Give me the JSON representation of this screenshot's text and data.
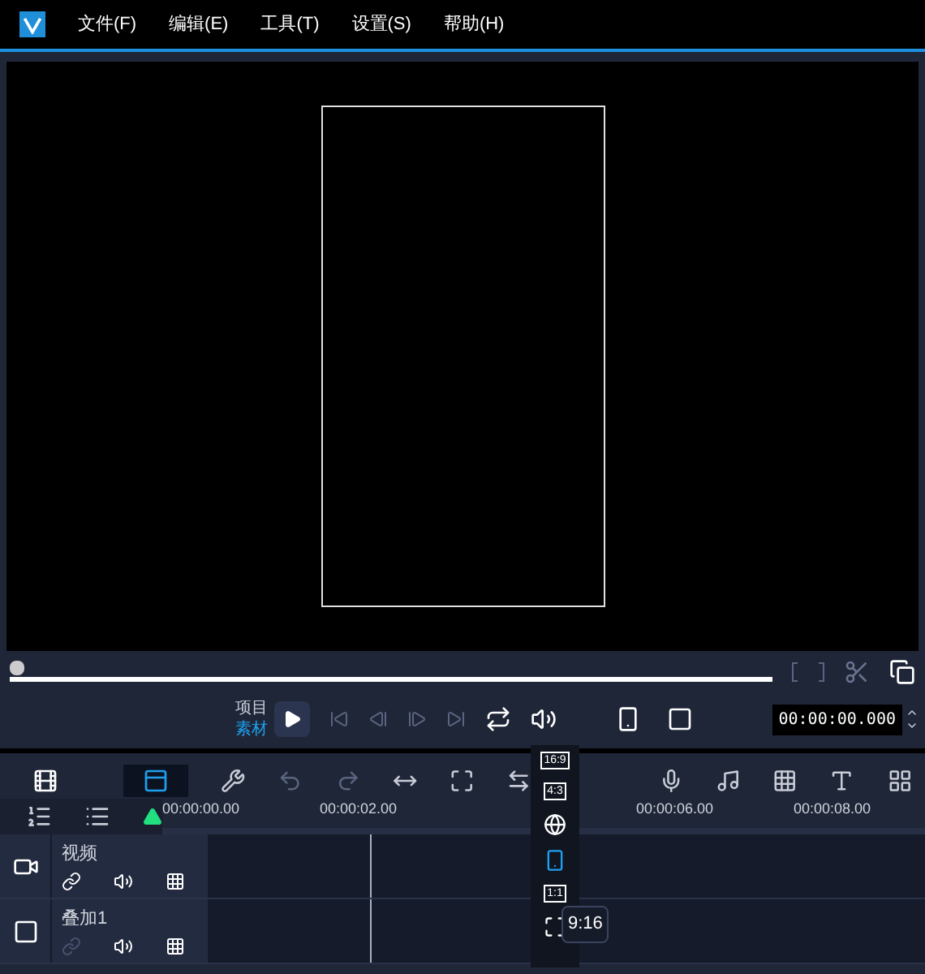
{
  "menu": [
    {
      "label": "文件(F)"
    },
    {
      "label": "编辑(E)"
    },
    {
      "label": "工具(T)"
    },
    {
      "label": "设置(S)"
    },
    {
      "label": "帮助(H)"
    }
  ],
  "player": {
    "level": 0,
    "modes": [
      {
        "label": "项目",
        "selected": false
      },
      {
        "label": "素材",
        "selected": true
      }
    ],
    "timecode": "00:00:00.000"
  },
  "view_tabs": [
    {
      "kind": "storyboard",
      "selected": false
    },
    {
      "kind": "timeline",
      "selected": true
    }
  ],
  "ruler": [
    "00:00:00.00",
    "00:00:02.00",
    "00:00:06.00",
    "00:00:08.00"
  ],
  "tracks": [
    {
      "name": "视频",
      "kind": "video",
      "link_enabled": true
    },
    {
      "name": "叠加1",
      "kind": "overlay",
      "link_enabled": false
    }
  ],
  "aspect_menu": [
    {
      "kind": "text",
      "label": "16:9",
      "selected": false
    },
    {
      "kind": "text",
      "label": "4:3",
      "selected": false
    },
    {
      "kind": "globe",
      "selected": false
    },
    {
      "kind": "phone",
      "selected": true
    },
    {
      "kind": "text",
      "label": "1:1",
      "selected": false
    },
    {
      "kind": "fit",
      "selected": false
    }
  ],
  "tooltip": "9:16"
}
